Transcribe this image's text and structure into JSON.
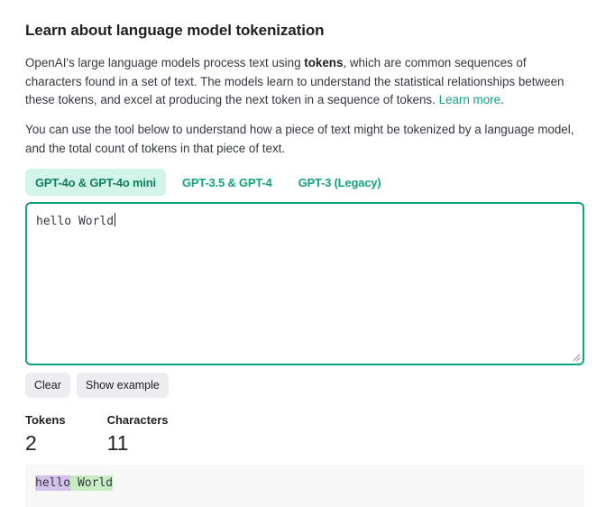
{
  "header": {
    "title": "Learn about language model tokenization"
  },
  "intro": {
    "part1": "OpenAI's large language models process text using ",
    "bold": "tokens",
    "part2": ", which are common sequences of characters found in a set of text. The models learn to understand the statistical relationships between these tokens, and excel at producing the next token in a sequence of tokens. ",
    "link": "Learn more",
    "end": "."
  },
  "usage": "You can use the tool below to understand how a piece of text might be tokenized by a language model, and the total count of tokens in that piece of text.",
  "tabs": [
    {
      "label": "GPT-4o & GPT-4o mini",
      "active": true
    },
    {
      "label": "GPT-3.5 & GPT-4",
      "active": false
    },
    {
      "label": "GPT-3 (Legacy)",
      "active": false
    }
  ],
  "editor": {
    "value": "hello World"
  },
  "buttons": {
    "clear": "Clear",
    "example": "Show example"
  },
  "stats": {
    "tokens_label": "Tokens",
    "tokens_value": "2",
    "chars_label": "Characters",
    "chars_value": "11"
  },
  "token_view": {
    "tokens": [
      "hello",
      " World"
    ]
  },
  "colors": {
    "accent": "#10a37f",
    "token_1": "#d5c2ec",
    "token_2": "#c6ecc3"
  }
}
